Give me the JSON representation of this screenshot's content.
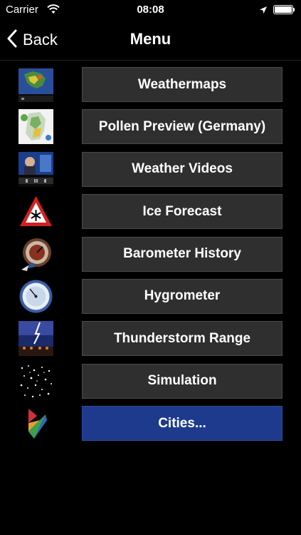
{
  "status_bar": {
    "carrier": "Carrier",
    "time": "08:08",
    "icons": [
      "wifi-icon",
      "location-arrow-icon",
      "battery-icon"
    ]
  },
  "nav": {
    "back_label": "Back",
    "title": "Menu"
  },
  "menu": [
    {
      "label": "Weathermaps",
      "icon": "weathermap-thumbnail"
    },
    {
      "label": "Pollen Preview (Germany)",
      "icon": "pollen-map-thumbnail"
    },
    {
      "label": "Weather Videos",
      "icon": "video-thumbnail"
    },
    {
      "label": "Ice Forecast",
      "icon": "ice-warning-sign-icon"
    },
    {
      "label": "Barometer History",
      "icon": "barometer-icon"
    },
    {
      "label": "Hygrometer",
      "icon": "hygrometer-icon"
    },
    {
      "label": "Thunderstorm Range",
      "icon": "lightning-thumbnail"
    },
    {
      "label": "Simulation",
      "icon": "simulation-thumbnail"
    },
    {
      "label": "Cities...",
      "icon": "app-logo-icon"
    }
  ],
  "colors": {
    "background": "#000000",
    "button": "#2f2f2f",
    "accent_button": "#1e3a8c"
  }
}
